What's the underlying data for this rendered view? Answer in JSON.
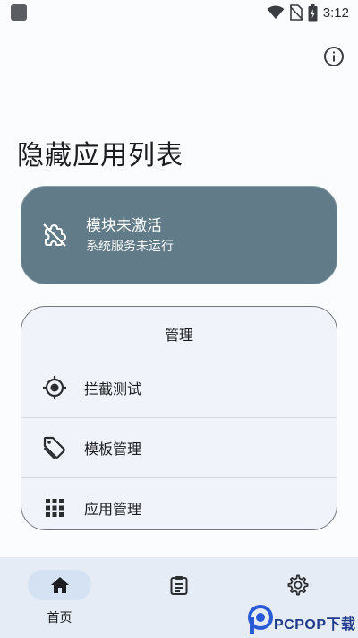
{
  "status_bar": {
    "time": "3:12"
  },
  "page": {
    "title": "隐藏应用列表"
  },
  "status_card": {
    "title": "模块未激活",
    "subtitle": "系统服务未运行",
    "color": "#627b88"
  },
  "manage": {
    "header": "管理",
    "items": [
      {
        "label": "拦截测试",
        "icon": "gps-target-icon"
      },
      {
        "label": "模板管理",
        "icon": "tag-icon"
      },
      {
        "label": "应用管理",
        "icon": "apps-grid-icon"
      }
    ]
  },
  "bottom_nav": {
    "items": [
      {
        "label": "首页",
        "icon": "home-icon",
        "active": true
      },
      {
        "label": "",
        "icon": "clipboard-icon",
        "active": false
      },
      {
        "label": "",
        "icon": "settings-icon",
        "active": false
      }
    ]
  },
  "watermark": {
    "text": "PCPOP下载"
  }
}
